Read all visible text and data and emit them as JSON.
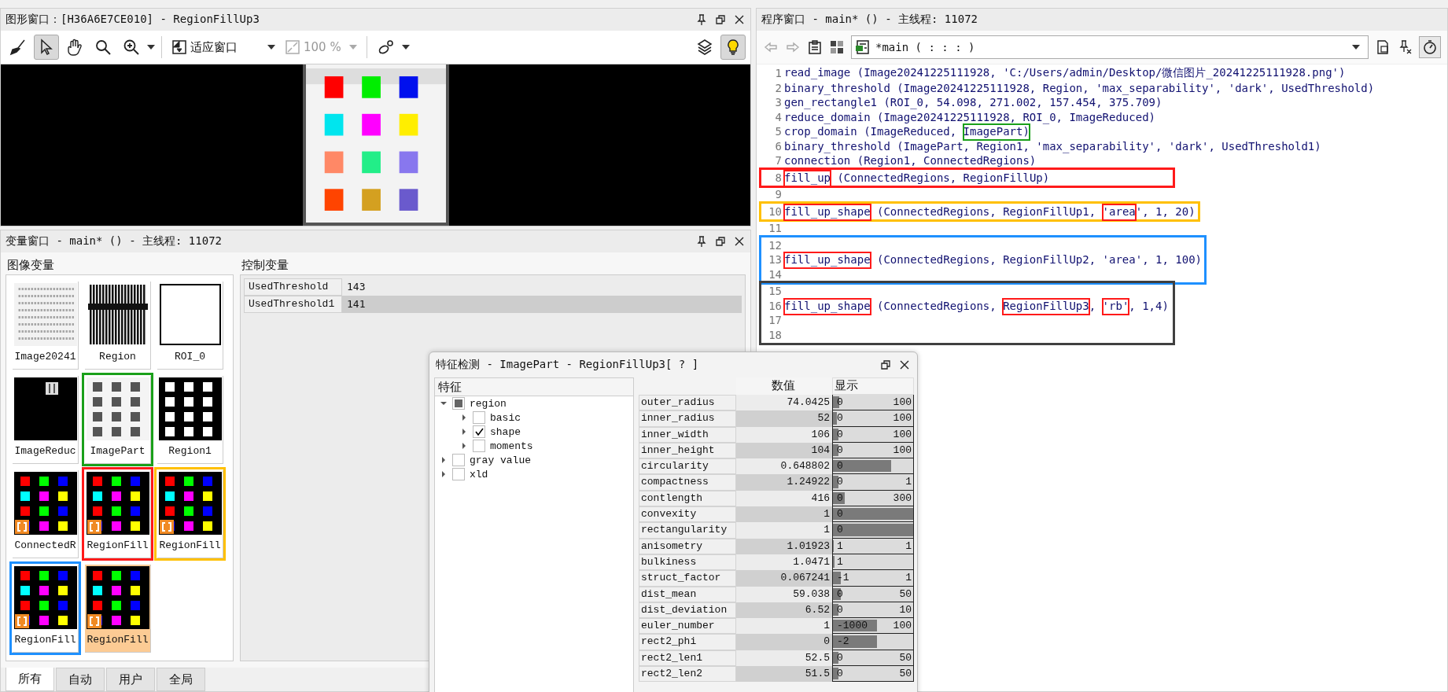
{
  "graphics_window": {
    "title": "图形窗口：[H36A6E7CE010] - RegionFillUp3",
    "tools": [
      {
        "selected": false
      },
      {
        "selected": true
      },
      {
        "selected": false
      },
      {
        "selected": false
      },
      {
        "selected": false
      }
    ],
    "fit_mode": "适应窗口",
    "zoom": {
      "value": "100 %",
      "disabled": true
    },
    "right_tools": [
      {
        "selected": false
      },
      {
        "selected": true
      }
    ]
  },
  "variable_window": {
    "title": "变量窗口 - main* () - 主线程: 11072",
    "image_heading": "图像变量",
    "control_heading": "控制变量",
    "image_variables": [
      {
        "label": "Image20241",
        "kind": "noise",
        "tuple": false,
        "selected": false
      },
      {
        "label": "Region",
        "kind": "stripes",
        "tuple": false,
        "selected": false
      },
      {
        "label": "ROI_0",
        "kind": "outline",
        "tuple": false,
        "selected": false
      },
      {
        "label": "ImageReduc",
        "kind": "reduced",
        "tuple": false,
        "selected": false
      },
      {
        "label": "ImagePart",
        "kind": "gray-glyphs",
        "tuple": false,
        "selected": false,
        "color": "#1aa01a"
      },
      {
        "label": "Region1",
        "kind": "binary-glyphs",
        "tuple": false,
        "selected": false
      },
      {
        "label": "ConnectedR",
        "kind": "color-glyphs",
        "tuple": true,
        "selected": false
      },
      {
        "label": "RegionFill",
        "kind": "color-glyphs",
        "tuple": true,
        "selected": false,
        "color": "#ff1a1a"
      },
      {
        "label": "RegionFill",
        "kind": "color-glyphs",
        "tuple": true,
        "selected": false,
        "color": "#ffc000"
      },
      {
        "label": "RegionFill",
        "kind": "color-glyphs",
        "tuple": true,
        "selected": false,
        "color": "#1e90ff"
      },
      {
        "label": "RegionFill",
        "kind": "color-glyphs",
        "tuple": true,
        "selected": true
      }
    ],
    "control_variables": [
      {
        "name": "UsedThreshold",
        "value": "143",
        "selected": false
      },
      {
        "name": "UsedThreshold1",
        "value": "141",
        "selected": true
      }
    ],
    "tabs": [
      {
        "label": "所有",
        "selected": true
      },
      {
        "label": "自动",
        "selected": false
      },
      {
        "label": "用户",
        "selected": false
      },
      {
        "label": "全局",
        "selected": false
      }
    ]
  },
  "program_window": {
    "title": "程序窗口 - main* () - 主线程: 11072",
    "back_enabled": false,
    "forward_enabled": false,
    "procedure": "*main ( : : : )",
    "blocks": [
      {
        "lines": [
          {
            "number": "1",
            "segments": [
              {
                "text": "read_image (Image20241225111928, 'C:/Users/admin/Desktop/微信图片_20241225111928.png')"
              }
            ]
          },
          {
            "number": "2",
            "segments": [
              {
                "text": "binary_threshold (Image20241225111928, Region, 'max_separability', 'dark', UsedThreshold)"
              }
            ]
          },
          {
            "number": "3",
            "segments": [
              {
                "text": "gen_rectangle1 (ROI_0, 54.098, 271.002, 157.454, 375.709)"
              }
            ]
          },
          {
            "number": "4",
            "segments": [
              {
                "text": "reduce_domain (Image20241225111928, ROI_0, ImageReduced)"
              }
            ]
          },
          {
            "number": "5",
            "segments": [
              {
                "text": "crop_domain (ImageReduced, "
              },
              {
                "text": "ImagePart)",
                "color": "#1aa01a"
              }
            ]
          },
          {
            "number": "6",
            "segments": [
              {
                "text": "binary_threshold (ImagePart, Region1, 'max_separability', 'dark', UsedThreshold1)"
              }
            ]
          },
          {
            "number": "7",
            "segments": [
              {
                "text": "connection (Region1, ConnectedRegions)"
              }
            ]
          }
        ]
      },
      {
        "color": "#ff1a1a",
        "lines": [
          {
            "number": "8",
            "segments": [
              {
                "text": "fill_up",
                "color": "#ff1a1a"
              },
              {
                "text": " (ConnectedRegions, RegionFillUp)"
              }
            ]
          }
        ]
      },
      {
        "lines": [
          {
            "number": "9"
          }
        ]
      },
      {
        "color": "#ffc000",
        "lines": [
          {
            "number": "10",
            "segments": [
              {
                "text": "fill_up_shape",
                "color": "#ff1a1a"
              },
              {
                "text": " (ConnectedRegions, RegionFillUp1, "
              },
              {
                "text": "'area",
                "color": "#ff1a1a"
              },
              {
                "text": "', 1, 20)"
              }
            ]
          }
        ]
      },
      {
        "lines": [
          {
            "number": "11"
          }
        ]
      },
      {
        "color": "#1e90ff",
        "lines": [
          {
            "number": "12"
          },
          {
            "number": "13",
            "segments": [
              {
                "text": "fill_up_shape",
                "color": "#ff1a1a"
              },
              {
                "text": " (ConnectedRegions, RegionFillUp2, 'area', 1, 100)"
              }
            ]
          },
          {
            "number": "14"
          }
        ]
      },
      {
        "color": "#404040",
        "lines": [
          {
            "number": "15"
          },
          {
            "number": "16",
            "segments": [
              {
                "text": "fill_up_shape",
                "color": "#ff1a1a"
              },
              {
                "text": " (ConnectedRegions, "
              },
              {
                "text": "RegionFillUp3",
                "color": "#ff1a1a"
              },
              {
                "text": ", "
              },
              {
                "text": "'rb'",
                "color": "#ff1a1a"
              },
              {
                "text": ", 1,4)"
              }
            ]
          },
          {
            "number": "17"
          },
          {
            "number": "18"
          }
        ]
      }
    ]
  },
  "feature_dialog": {
    "title": "特征检测 - ImagePart - RegionFillUp3[ ? ]",
    "tree_heading": "特征",
    "value_heading": "数值",
    "display_heading": "显示",
    "tree": [
      {
        "label": "region",
        "expanded": true,
        "checked": false,
        "mixed": true,
        "children": [
          {
            "label": "basic",
            "expanded": false,
            "checked": false,
            "mixed": false
          },
          {
            "label": "shape",
            "expanded": false,
            "checked": true,
            "mixed": false
          },
          {
            "label": "moments",
            "expanded": false,
            "checked": false,
            "mixed": false
          }
        ]
      },
      {
        "label": "gray value",
        "expanded": false,
        "checked": false,
        "mixed": false
      },
      {
        "label": "xld",
        "expanded": false,
        "checked": false,
        "mixed": false
      }
    ],
    "rows": [
      {
        "name": "outer_radius",
        "value": "74.0425",
        "min": "0",
        "max": "100",
        "level": 0.08
      },
      {
        "name": "inner_radius",
        "value": "52",
        "min": "0",
        "max": "100",
        "level": 0.05
      },
      {
        "name": "inner_width",
        "value": "106",
        "min": "0",
        "max": "100",
        "level": 0.07
      },
      {
        "name": "inner_height",
        "value": "104",
        "min": "0",
        "max": "100",
        "level": 0.07
      },
      {
        "name": "circularity",
        "value": "0.648802",
        "min": "0",
        "level": 0.73
      },
      {
        "name": "compactness",
        "value": "1.24922",
        "min": "0",
        "max": "1",
        "level": 0.07
      },
      {
        "name": "contlength",
        "value": "416",
        "min": "0",
        "max": "300",
        "level": 0.15
      },
      {
        "name": "convexity",
        "value": "1",
        "min": "0",
        "level": 1
      },
      {
        "name": "rectangularity",
        "value": "1",
        "min": "0",
        "level": 1
      },
      {
        "name": "anisometry",
        "value": "1.01923",
        "min": "1",
        "max": "1",
        "level": 0.01
      },
      {
        "name": "bulkiness",
        "value": "1.0471",
        "min": "1",
        "level": 0.02
      },
      {
        "name": "struct_factor",
        "value": "0.067241",
        "min": "-1",
        "max": "1",
        "level": 0.1
      },
      {
        "name": "dist_mean",
        "value": "59.038",
        "min": "0",
        "max": "50",
        "level": 0.1
      },
      {
        "name": "dist_deviation",
        "value": "6.52",
        "min": "0",
        "max": "10",
        "level": 0.07
      },
      {
        "name": "euler_number",
        "value": "1",
        "min": "-1000",
        "max": "100",
        "level": 0.55
      },
      {
        "name": "rect2_phi",
        "value": "0",
        "min": "-2",
        "level": 0.55
      },
      {
        "name": "rect2_len1",
        "value": "52.5",
        "min": "0",
        "max": "50",
        "level": 0.07
      },
      {
        "name": "rect2_len2",
        "value": "51.5",
        "min": "0",
        "max": "50",
        "level": 0.07
      }
    ]
  }
}
